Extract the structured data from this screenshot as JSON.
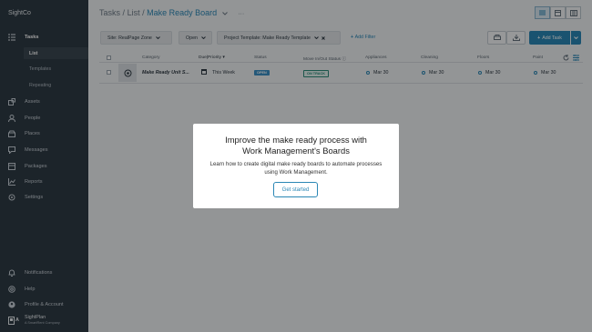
{
  "brand": "SightCo",
  "sidebar": {
    "items": [
      {
        "label": "Tasks",
        "icon": "tasks-icon"
      },
      {
        "label": "Assets",
        "icon": "assets-icon"
      },
      {
        "label": "People",
        "icon": "people-icon"
      },
      {
        "label": "Places",
        "icon": "places-icon"
      },
      {
        "label": "Messages",
        "icon": "messages-icon"
      },
      {
        "label": "Packages",
        "icon": "packages-icon"
      },
      {
        "label": "Reports",
        "icon": "reports-icon"
      },
      {
        "label": "Settings",
        "icon": "settings-icon"
      }
    ],
    "subitems": [
      "List",
      "Templates",
      "Repeating"
    ],
    "footer": [
      {
        "label": "Notifications",
        "icon": "bell-icon"
      },
      {
        "label": "Help",
        "icon": "help-icon"
      },
      {
        "label": "Profile & Account",
        "icon": "profile-icon"
      }
    ],
    "logo_text": "SightPlan",
    "logo_sub": "A SmartRent Company",
    "logo_mark": "A"
  },
  "header": {
    "crumb_tasks": "Tasks",
    "sep1": "/",
    "crumb_list": "List",
    "sep2": "/",
    "board": "Make Ready Board",
    "more": "···"
  },
  "filters": {
    "site": "Site: RealPage Zone",
    "status": "Open",
    "template": "Project Template: Make Ready Template",
    "add_filter": "Add Filter"
  },
  "toolbar": {
    "add_task": "Add Task"
  },
  "table": {
    "columns": [
      "Category",
      "Due|Priority",
      "Status",
      "Move In/Out Status",
      "Appliances",
      "Cleaning",
      "Floors",
      "Paint"
    ],
    "row": {
      "name": "Make Ready Unit S...",
      "due": "This Week",
      "status": "OPEN",
      "move_status": "ON TRACK",
      "appliances": "Mar 30",
      "cleaning": "Mar 30",
      "floors": "Mar 30",
      "paint": "Mar 30"
    }
  },
  "modal": {
    "title_line1": "Improve the make ready process with",
    "title_line2": "Work Management's Boards",
    "body": "Learn how to create digital make ready boards to automate processes using Work Management.",
    "button": "Get started"
  },
  "colors": {
    "accent": "#2b87b5",
    "sidebar": "#2e3a44",
    "status_open": "#3b8fc4",
    "on_track": "#2c8a7a"
  }
}
